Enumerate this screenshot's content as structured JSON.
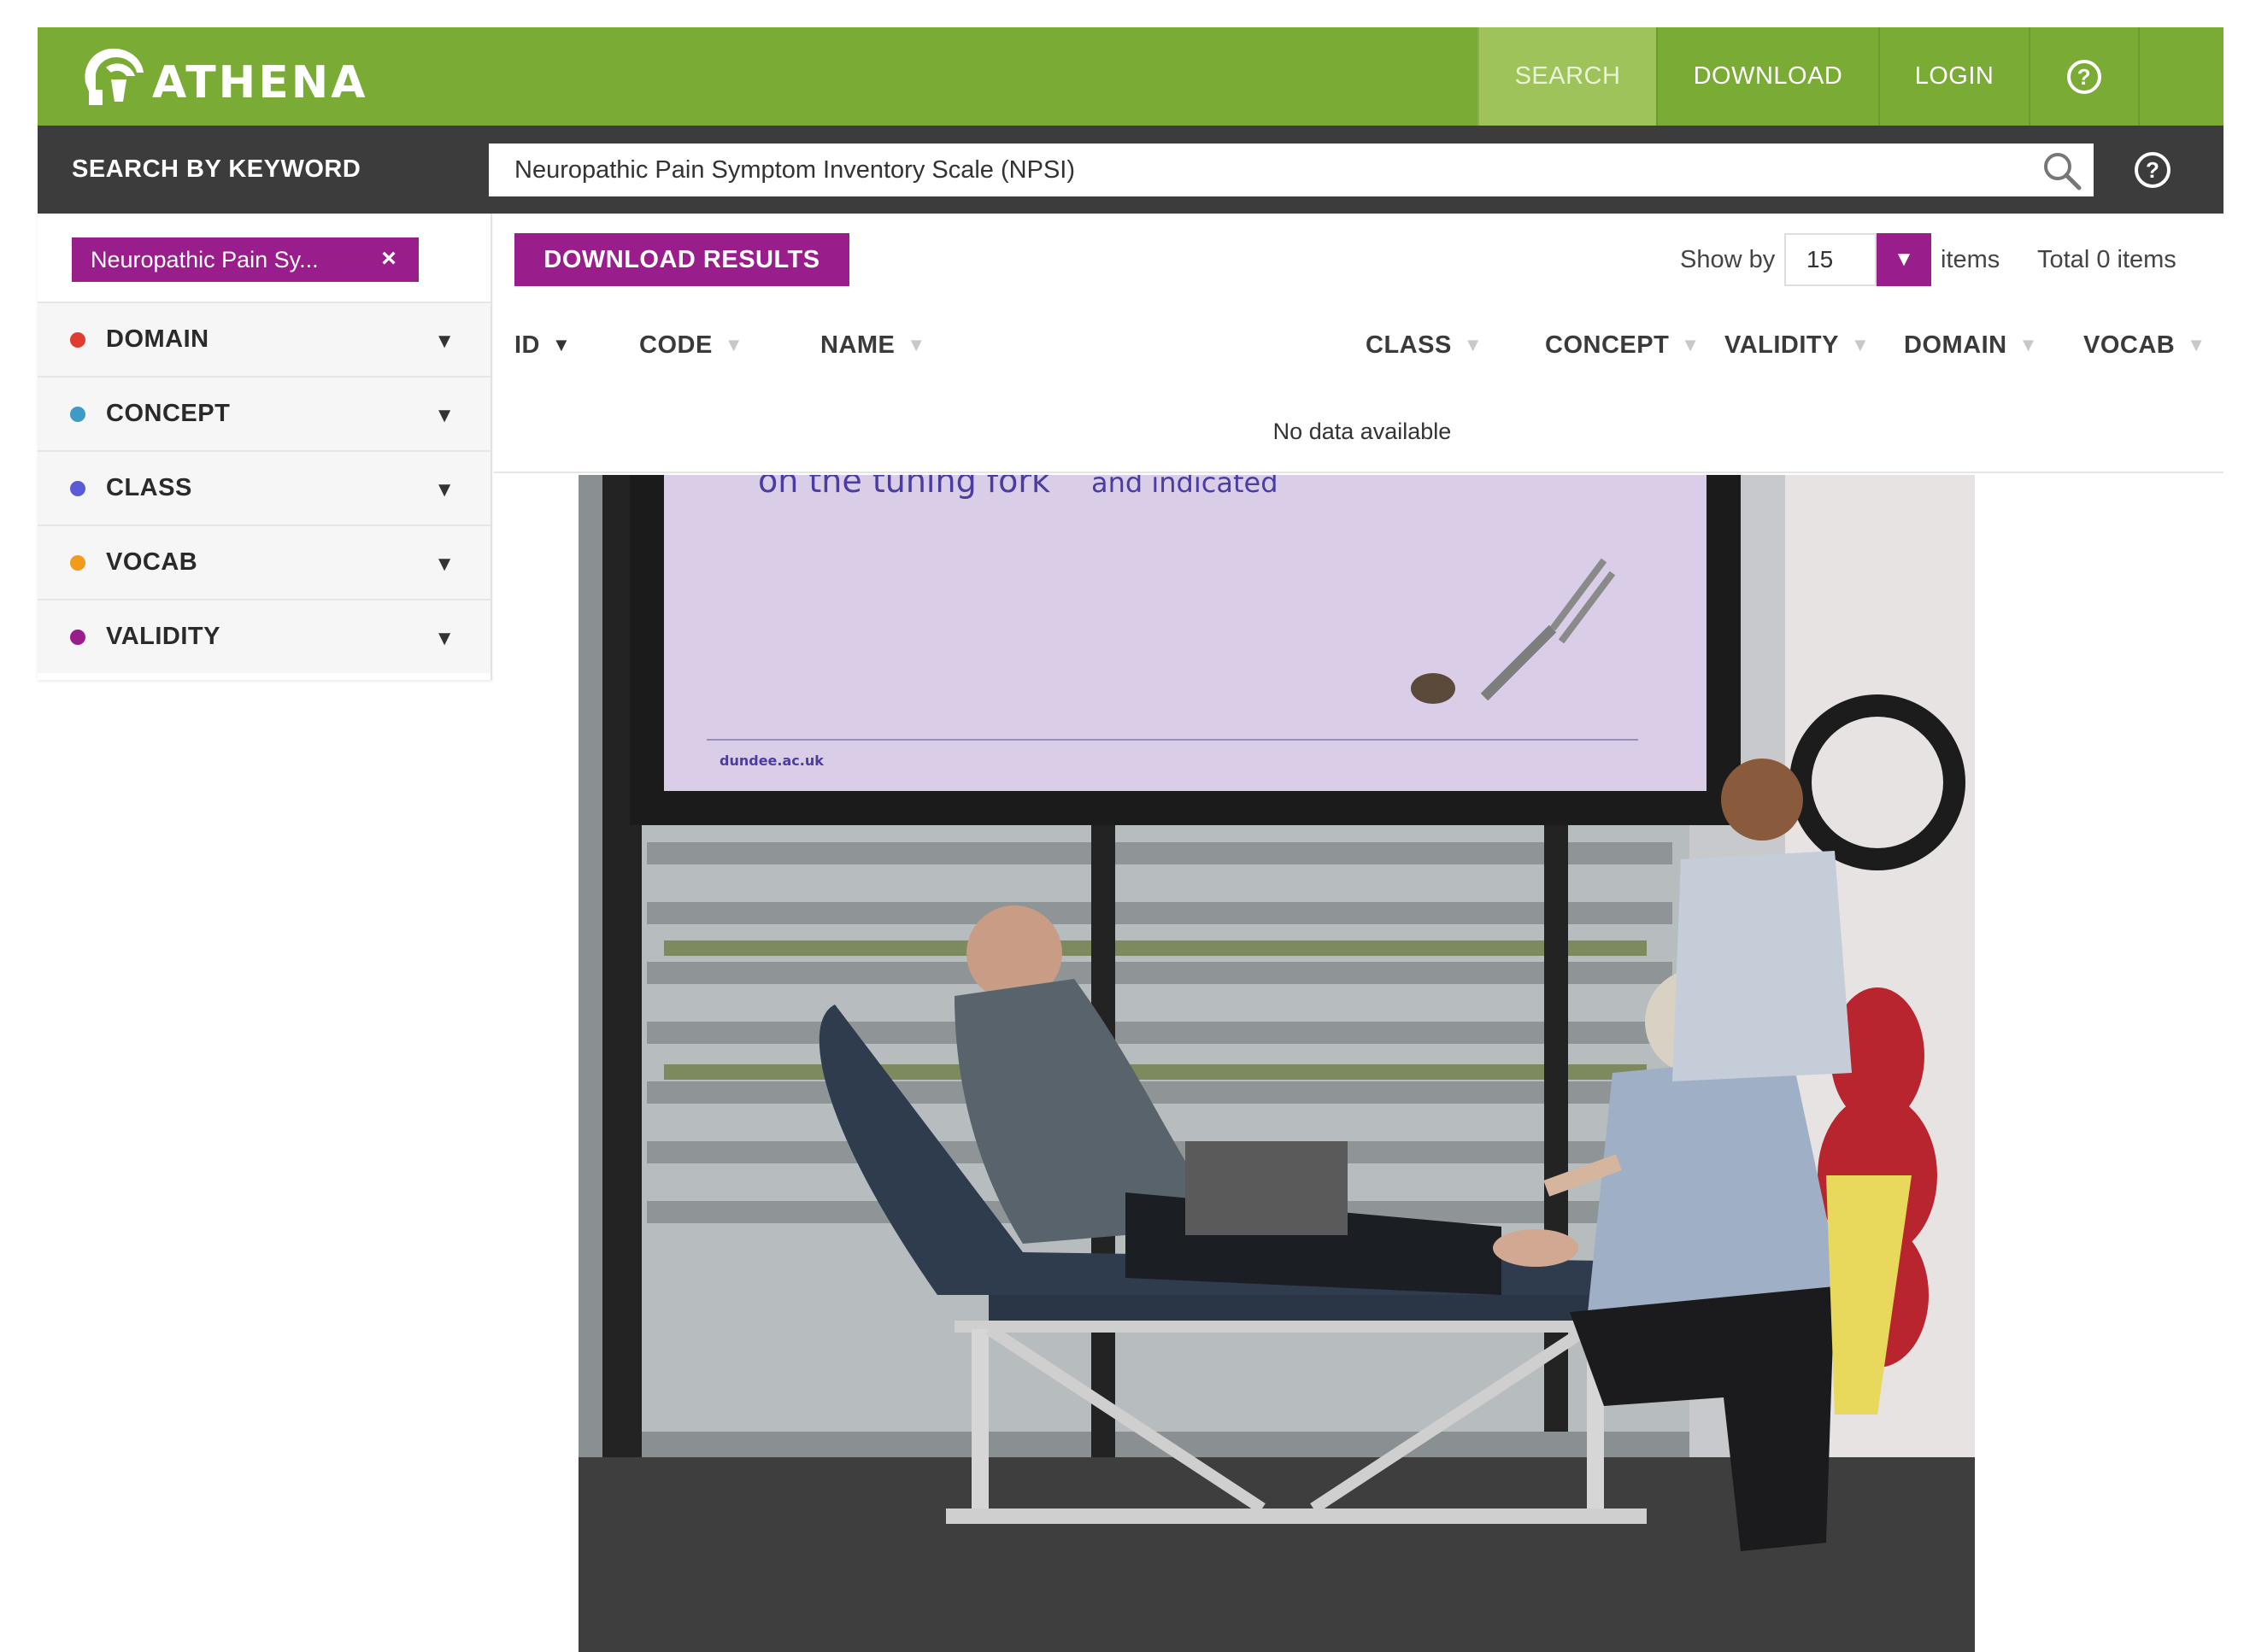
{
  "app": {
    "brand": "ATHENA",
    "nav": {
      "search": "SEARCH",
      "download": "DOWNLOAD",
      "login": "LOGIN",
      "help": "?"
    }
  },
  "search": {
    "label": "SEARCH BY KEYWORD",
    "value": "Neuropathic Pain Symptom Inventory Scale (NPSI)",
    "help": "?"
  },
  "filters": {
    "active_chip": "Neuropathic Pain Sy...",
    "chip_close": "×",
    "facets": [
      {
        "label": "DOMAIN",
        "color": "#e03c31"
      },
      {
        "label": "CONCEPT",
        "color": "#3d9bc4"
      },
      {
        "label": "CLASS",
        "color": "#5b5bd6"
      },
      {
        "label": "VOCAB",
        "color": "#f29a1a"
      },
      {
        "label": "VALIDITY",
        "color": "#9a1d8c"
      }
    ]
  },
  "results": {
    "download_label": "DOWNLOAD RESULTS",
    "show_by_label": "Show by",
    "page_size": "15",
    "items_label": "items",
    "total_label": "Total 0 items",
    "columns": [
      "ID",
      "CODE",
      "NAME",
      "CLASS",
      "CONCEPT",
      "VALIDITY",
      "DOMAIN",
      "VOCAB"
    ],
    "empty_message": "No data available"
  },
  "photo": {
    "slide_text_1": "on the tuning fork",
    "slide_text_2": "and indicated",
    "slide_footer": "dundee.ac.uk"
  },
  "colors": {
    "brand_green": "#7aab35",
    "active_nav": "#9ec35a",
    "accent_purple": "#9a1d8c",
    "dark_bar": "#3c3c3c"
  }
}
